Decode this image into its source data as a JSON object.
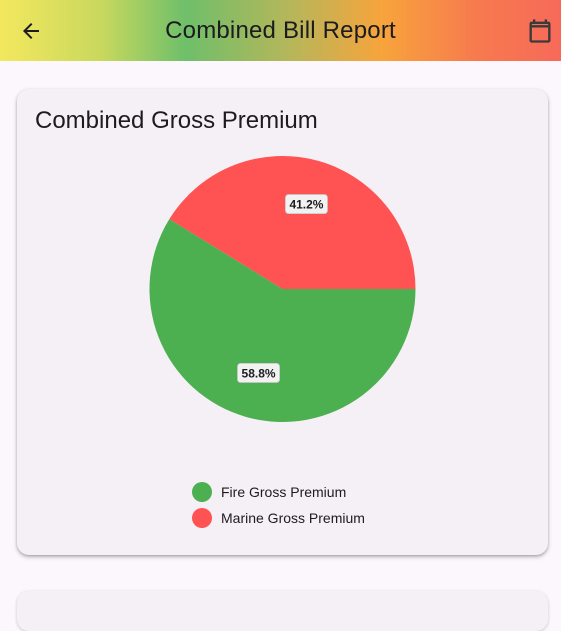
{
  "app_bar": {
    "title": "Combined Bill Report",
    "back_icon": "arrow-back-icon",
    "calendar_icon": "calendar-icon"
  },
  "card": {
    "title": "Combined Gross Premium"
  },
  "chart_data": {
    "type": "pie",
    "title": "Combined Gross Premium",
    "series": [
      {
        "name": "Fire Gross Premium",
        "value": 58.8,
        "label": "58.8%",
        "color": "#4caf50"
      },
      {
        "name": "Marine Gross Premium",
        "value": 41.2,
        "label": "41.2%",
        "color": "#ff5252"
      }
    ],
    "legend_position": "bottom"
  }
}
